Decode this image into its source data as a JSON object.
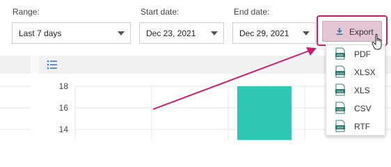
{
  "filters": {
    "range": {
      "label": "Range:",
      "value": "Last 7 days"
    },
    "start_date": {
      "label": "Start date:",
      "value": "Dec 23, 2021"
    },
    "end_date": {
      "label": "End date:",
      "value": "Dec 29, 2021"
    }
  },
  "toolbar": {
    "export_label": "Export",
    "export_icon": "download-icon",
    "list_icon": "list-icon"
  },
  "export_menu": {
    "items": [
      {
        "label": "PDF",
        "icon": "pdf-file-icon"
      },
      {
        "label": "XLSX",
        "icon": "xlsx-file-icon"
      },
      {
        "label": "XLS",
        "icon": "xls-file-icon"
      },
      {
        "label": "CSV",
        "icon": "csv-file-icon"
      },
      {
        "label": "RTF",
        "icon": "rtf-file-icon"
      }
    ]
  },
  "chart_data": {
    "type": "bar",
    "y_ticks": [
      18,
      16,
      14
    ],
    "bar_color": "#2ec8b4",
    "values": [
      18
    ]
  },
  "colors": {
    "accent": "#d11a6b",
    "highlight_fill": "#e3c6d3",
    "bar": "#2ec8b4"
  }
}
